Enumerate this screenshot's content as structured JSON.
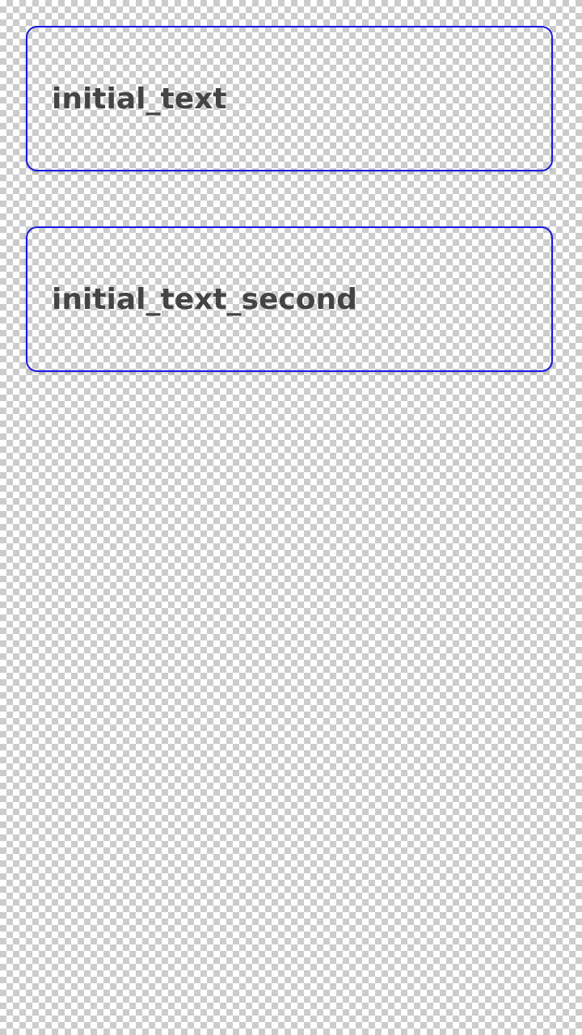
{
  "fields": [
    {
      "value": "initial_text"
    },
    {
      "value": "initial_text_second"
    }
  ],
  "colors": {
    "field_border": "#1a17e6",
    "text": "#444444"
  }
}
